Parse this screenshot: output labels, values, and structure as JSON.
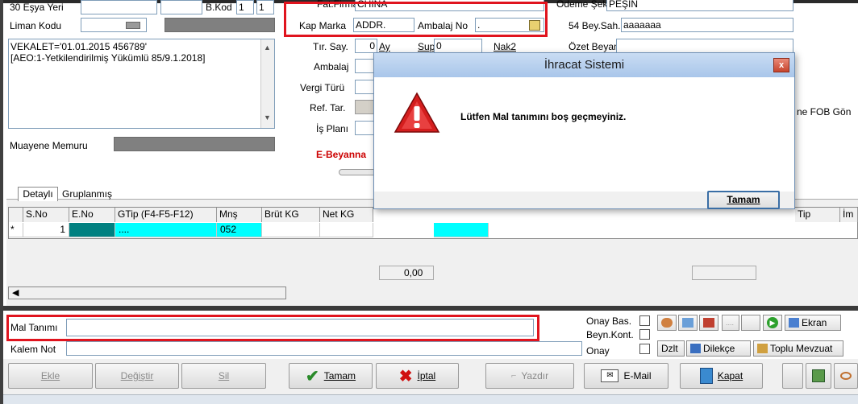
{
  "top": {
    "esya_yeri_label": "30 Eşya Yeri",
    "b_kod_label": "B.Kod",
    "b_kod_value": "1",
    "b_kod_value2": "1",
    "fat_firma_label": "Fat.Firma",
    "fat_firma_value": "CHINA",
    "odeme_sekli_label": "Ödeme Şekli",
    "odeme_sekli_value": "PEŞİN",
    "liman_kodu_label": "Liman Kodu",
    "kap_marka_label": "Kap Marka",
    "kap_marka_value": "ADDR.",
    "ambalaj_no_label": "Ambalaj No",
    "ambalaj_no_value": ".",
    "bey_sah_label": "54 Bey.Sah.",
    "bey_sah_value": "aaaaaaa",
    "tir_say_label": "Tır. Say.",
    "tir_say_value": "0",
    "ay_label": "Ay",
    "sup_label": "Sup",
    "sup_value": "0",
    "nak2_label": "Nak2",
    "ozet_beyan_label": "Özet Beyan",
    "ambalaj_label": "Ambalaj",
    "vergi_turu_label": "Vergi Türü",
    "ref_tar_label": "Ref. Tar.",
    "is_plani_label": "İş Planı",
    "fob_label": "ne FOB Gön",
    "muayene_label": "Muayene Memuru",
    "ebeyanname_label": "E-Beyanna",
    "notes_line1": "VEKALET='01.01.2015 456789'",
    "notes_line2": "[AEO:1-Yetkilendirilmiş Yükümlü 85/9.1.2018]"
  },
  "tabs": [
    "Detaylı",
    "Gruplanmış"
  ],
  "grid": {
    "headers": [
      "S.No",
      "E.No",
      "GTip (F4-F5-F12)",
      "Mnş",
      "Brüt KG",
      "Net KG",
      "Tip",
      "İm"
    ],
    "row_marker": "*",
    "row": {
      "sno": "1",
      "eno": "",
      "gtip": "....",
      "mns": "052"
    },
    "total": "0,00"
  },
  "bottom": {
    "mal_tanimi_label": "Mal Tanımı",
    "kalem_not_label": "Kalem Not",
    "onay_bas_label": "Onay Bas.",
    "beyn_kont_label": "Beyn.Kont.",
    "onay_label": "Onay",
    "ekran_label": "Ekran",
    "dzlt_label": "Dzlt",
    "dilekce_label": "Dilekçe",
    "toplu_mevzuat_label": "Toplu Mevzuat",
    "ellipsis_label": "...."
  },
  "buttons": {
    "ekle": "Ekle",
    "degistir": "Değiştir",
    "sil": "Sil",
    "tamam": "Tamam",
    "iptal": "İptal",
    "yazdir": "Yazdır",
    "email": "E-Mail",
    "kapat": "Kapat"
  },
  "dialog": {
    "title": "İhracat Sistemi",
    "message": "Lütfen Mal tanımını boş geçmeyiniz.",
    "ok_label": "Tamam",
    "close_label": "x"
  },
  "colors": {
    "highlight_red": "#e0141e",
    "teal": "#008080",
    "cyan": "#00ffff",
    "ebeyan_red": "#cc0000"
  }
}
